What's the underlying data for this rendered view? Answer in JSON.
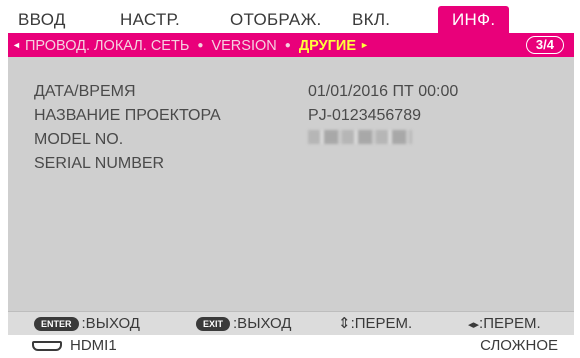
{
  "tabs": [
    "ВВОД",
    "НАСТР.",
    "ОТОБРАЖ.",
    "ВКЛ.",
    "ИНФ."
  ],
  "active_tab": "ИНФ.",
  "subtabs": {
    "left_arrow": "◄",
    "items": [
      "ПРОВОД. ЛОКАЛ. СЕТЬ",
      "VERSION",
      "ДРУГИЕ"
    ],
    "separator": "●",
    "active": "ДРУГИЕ",
    "right_arrow": "►",
    "page_indicator": "3/4"
  },
  "info": {
    "rows": [
      {
        "label": "ДАТА/ВРЕМЯ",
        "value": "01/01/2016 ПТ 00:00"
      },
      {
        "label": "НАЗВАНИЕ ПРОЕКТОРА",
        "value": "PJ-0123456789"
      },
      {
        "label": "MODEL NO.",
        "value": ""
      },
      {
        "label": "SERIAL NUMBER",
        "value": ""
      }
    ]
  },
  "footer": {
    "enter_key": "ENTER",
    "enter_action": ":ВЫХОД",
    "exit_key": "EXIT",
    "exit_action": ":ВЫХОД",
    "updown_icon": "⇕",
    "updown_action": ":ПЕРЕМ.",
    "leftright_icon": "◂▸",
    "leftright_action": ":ПЕРЕМ."
  },
  "status": {
    "input_icon": "hdmi-icon",
    "input": "HDMI1",
    "mode": "СЛОЖНОЕ"
  },
  "colors": {
    "accent": "#e9007a",
    "active_subtab": "#ffff3c",
    "panel": "#cfcfcf",
    "text": "#4a4a4a"
  }
}
